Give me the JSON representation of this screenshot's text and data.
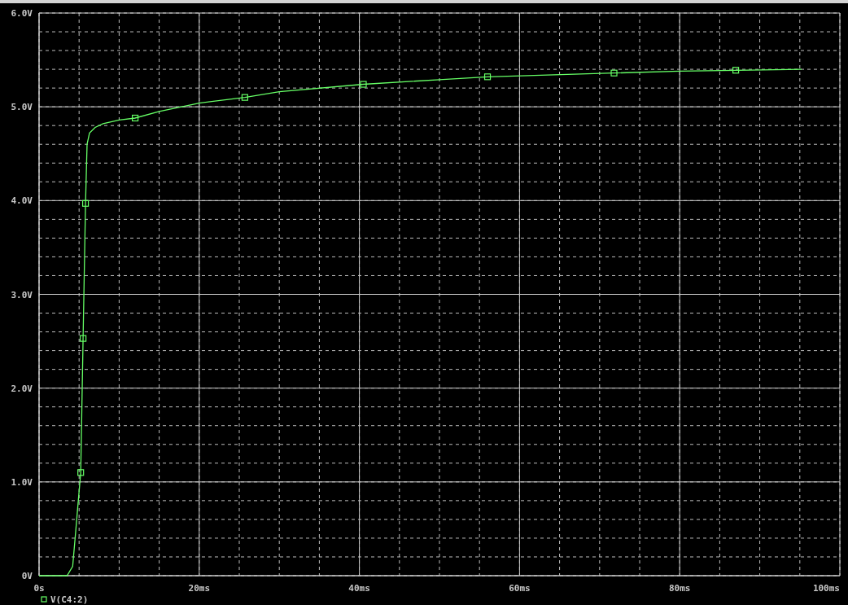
{
  "chart_data": {
    "type": "line",
    "grid": true,
    "x": [
      0,
      3.5,
      4.2,
      4.6,
      5.0,
      5.2,
      5.5,
      5.8,
      6.0,
      6.3,
      7,
      8,
      10,
      12,
      15,
      20,
      25.7,
      30,
      40.5,
      50,
      56,
      71.8,
      80,
      87,
      95.2
    ],
    "series": [
      {
        "name": "V(C4:2)",
        "color": "#66ff66",
        "values": [
          0,
          0,
          0.1,
          0.5,
          0.9,
          1.1,
          2.53,
          3.97,
          4.6,
          4.72,
          4.78,
          4.82,
          4.86,
          4.88,
          4.95,
          5.04,
          5.1,
          5.16,
          5.24,
          5.29,
          5.32,
          5.36,
          5.38,
          5.39,
          5.4
        ]
      }
    ],
    "xlim": [
      0,
      100
    ],
    "ylim": [
      0,
      6
    ],
    "xticks": [
      {
        "value": 0,
        "label": "0s"
      },
      {
        "value": 20,
        "label": "20ms"
      },
      {
        "value": 40,
        "label": "40ms"
      },
      {
        "value": 60,
        "label": "60ms"
      },
      {
        "value": 80,
        "label": "80ms"
      },
      {
        "value": 100,
        "label": "100ms"
      }
    ],
    "yticks": [
      {
        "value": 0,
        "label": "0V"
      },
      {
        "value": 1,
        "label": "1.0V"
      },
      {
        "value": 2,
        "label": "2.0V"
      },
      {
        "value": 3,
        "label": "3.0V"
      },
      {
        "value": 4,
        "label": "4.0V"
      },
      {
        "value": 5,
        "label": "5.0V"
      },
      {
        "value": 6,
        "label": "6.0V"
      }
    ]
  }
}
